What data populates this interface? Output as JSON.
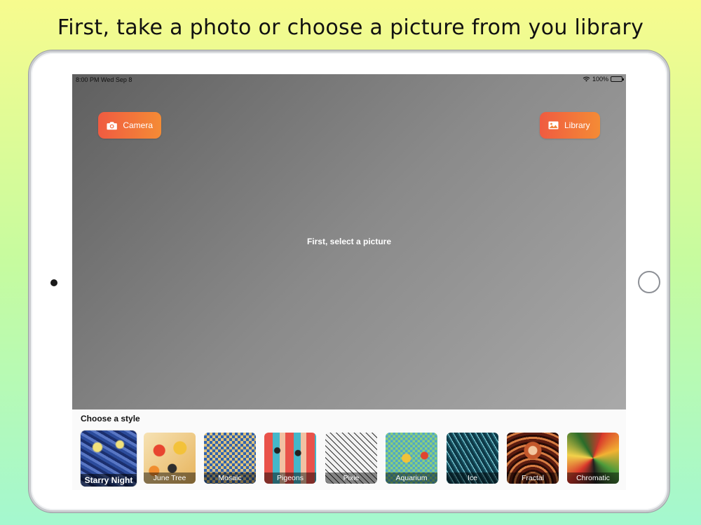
{
  "headline": "First, take a photo or choose a picture from you library",
  "status_bar": {
    "time": "8:00 PM  Wed Sep 8",
    "battery": "100%"
  },
  "buttons": {
    "camera": "Camera",
    "library": "Library"
  },
  "photo_area": {
    "message": "First, select a picture"
  },
  "style_panel": {
    "title": "Choose a style",
    "styles": [
      {
        "label": "Starry Night",
        "selected": true
      },
      {
        "label": "June Tree"
      },
      {
        "label": "Mosaic"
      },
      {
        "label": "Pigeons"
      },
      {
        "label": "Pixie"
      },
      {
        "label": "Aquarium"
      },
      {
        "label": "Ice"
      },
      {
        "label": "Fractal"
      },
      {
        "label": "Chromatic"
      }
    ]
  },
  "colors": {
    "button_gradient_start": "#f05b41",
    "button_gradient_end": "#f48b35",
    "background_top": "#f7fb8e",
    "background_bottom": "#a4f8cf"
  },
  "icons": [
    "camera-icon",
    "photo-library-icon",
    "wifi-icon",
    "battery-icon"
  ]
}
